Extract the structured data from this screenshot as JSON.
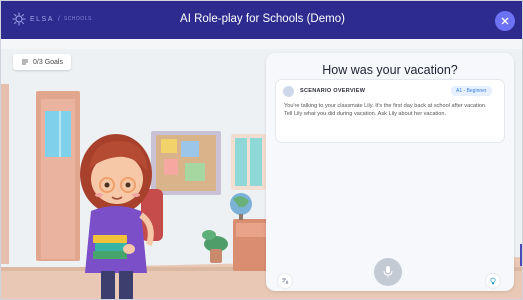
{
  "header": {
    "brand": "ELSA",
    "brand_sub": "SCHOOLS",
    "title": "AI Role-play for Schools (Demo)"
  },
  "goals": {
    "label": "0/3 Goals"
  },
  "panel": {
    "title": "How was your vacation?",
    "card": {
      "heading": "SCENARIO OVERVIEW",
      "level": "A1 - Beginner",
      "body": "You're talking to your classmate Lily. It's the first day back at school after vacation. Tell Lily what you did during vacation. Ask Lily about her vacation."
    }
  },
  "icons": {
    "close": "close-icon",
    "goals": "checklist-icon",
    "translate": "translate-icon",
    "mic": "microphone-icon",
    "hint": "lightbulb-icon"
  },
  "colors": {
    "header_bg": "#2e2b8f",
    "accent": "#6d72f5",
    "badge": "#3a7de0"
  }
}
